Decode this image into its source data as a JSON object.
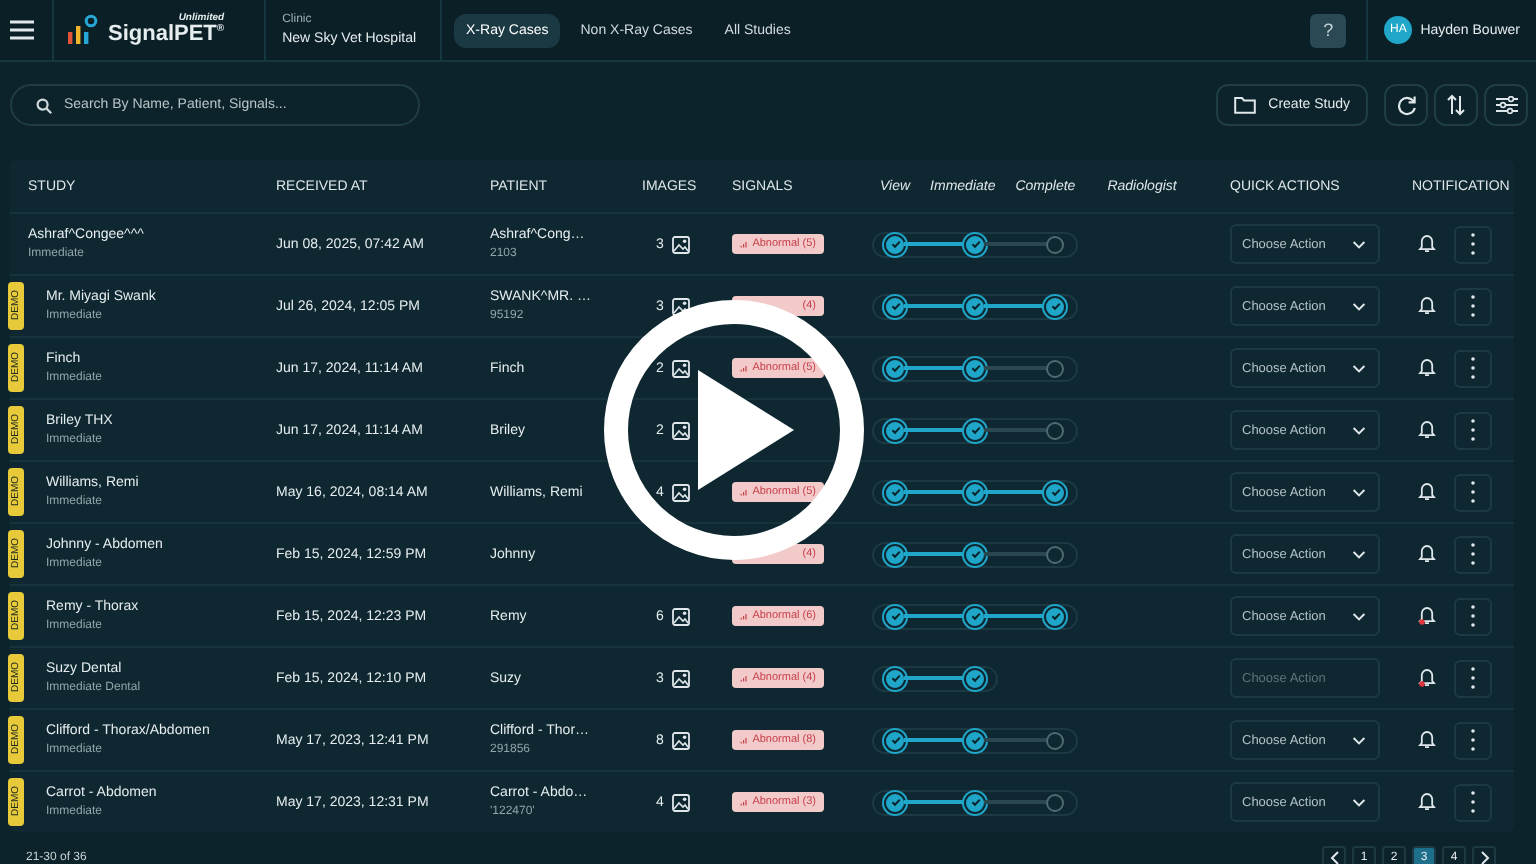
{
  "header": {
    "logo": {
      "tagline": "Unlimited",
      "name": "SignalPET$^{®}$"
    },
    "clinic": {
      "label": "Clinic",
      "name": "New Sky Vet Hospital"
    },
    "tabs": [
      {
        "label": "X-Ray Cases",
        "selected": true
      },
      {
        "label": "Non X-Ray Cases",
        "selected": false
      },
      {
        "label": "All Studies",
        "selected": false
      }
    ],
    "help": "?",
    "user": {
      "initials": "HA",
      "name": "Hayden Bouwer"
    }
  },
  "toolbar": {
    "search": {
      "placeholder": "Search By Name, Patient, Signals..."
    },
    "create_button": "Create Study"
  },
  "table": {
    "columns": [
      {
        "label": "STUDY",
        "kind": "field"
      },
      {
        "label": "RECEIVED AT",
        "kind": "field"
      },
      {
        "label": "PATIENT",
        "kind": "field"
      },
      {
        "label": "IMAGES",
        "kind": "field"
      },
      {
        "label": "SIGNALS",
        "kind": "field"
      },
      {
        "label": "View",
        "kind": "step"
      },
      {
        "label": "Immediate",
        "kind": "step"
      },
      {
        "label": "Complete",
        "kind": "step"
      },
      {
        "label": "Radiologist",
        "kind": "step"
      },
      {
        "label": "QUICK ACTIONS",
        "kind": "field"
      },
      {
        "label": "NOTIFICATION",
        "kind": "field"
      }
    ],
    "rows": [
      {
        "study": "Ashraf^Congee^^^",
        "priority": "Immediate",
        "received": "Jun 08, 2025, 07:42 AM",
        "patient": "Ashraf^Cong…",
        "patient_id": "2103",
        "images": "3",
        "signal": "Abnormal (5)",
        "steps": [
          true,
          true,
          false
        ],
        "action": {
          "text": "Choose Action",
          "disabled": false
        },
        "alert": false
      },
      {
        "tag": "DEMO",
        "study": "Mr. Miyagi Swank",
        "priority": "Immediate",
        "received": "Jul 26, 2024, 12:05 PM",
        "patient": "SWANK^MR. …",
        "patient_id": "95192",
        "images": "3",
        "signal": "(4)",
        "signal_icon": false,
        "steps": [
          true,
          true,
          true
        ],
        "action": {
          "text": "Choose Action",
          "disabled": false
        },
        "alert": false
      },
      {
        "tag": "DEMO",
        "study": "Finch",
        "priority": "Immediate",
        "received": "Jun 17, 2024, 11:14 AM",
        "patient": "Finch",
        "images": "2",
        "signal": "Abnormal (5)",
        "steps": [
          true,
          true,
          false
        ],
        "action": {
          "text": "Choose Action",
          "disabled": false
        },
        "alert": false
      },
      {
        "tag": "DEMO",
        "study": "Briley THX",
        "priority": "Immediate",
        "received": "Jun 17, 2024, 11:14 AM",
        "patient": "Briley",
        "images": "2",
        "steps": [
          true,
          true,
          false
        ],
        "action": {
          "text": "Choose Action",
          "disabled": false
        },
        "alert": false
      },
      {
        "tag": "DEMO",
        "study": "Williams, Remi",
        "priority": "Immediate",
        "received": "May 16, 2024, 08:14 AM",
        "patient": "Williams, Remi",
        "images": "4",
        "signal": "Abnormal (5)",
        "steps": [
          true,
          true,
          true
        ],
        "action": {
          "text": "Choose Action",
          "disabled": false
        },
        "alert": false
      },
      {
        "tag": "DEMO",
        "study": "Johnny - Abdomen",
        "priority": "Immediate",
        "received": "Feb 15, 2024, 12:59 PM",
        "patient": "Johnny",
        "signal": "(4)",
        "signal_icon": false,
        "steps": [
          true,
          true,
          false
        ],
        "action": {
          "text": "Choose Action",
          "disabled": false
        },
        "alert": false
      },
      {
        "tag": "DEMO",
        "study": "Remy - Thorax",
        "priority": "Immediate",
        "received": "Feb 15, 2024, 12:23 PM",
        "patient": "Remy",
        "images": "6",
        "signal": "Abnormal (6)",
        "steps": [
          true,
          true,
          true
        ],
        "action": {
          "text": "Choose Action",
          "disabled": false
        },
        "alert": true
      },
      {
        "tag": "DEMO",
        "study": "Suzy Dental",
        "priority": "Immediate Dental",
        "received": "Feb 15, 2024, 12:10 PM",
        "patient": "Suzy",
        "images": "3",
        "signal": "Abnormal (4)",
        "steps": [
          true,
          true
        ],
        "action": {
          "text": "Choose Action",
          "disabled": true
        },
        "alert": true
      },
      {
        "tag": "DEMO",
        "study": "Clifford - Thorax/Abdomen",
        "priority": "Immediate",
        "received": "May 17, 2023, 12:41 PM",
        "patient": "Clifford - Thor…",
        "patient_id": "291856",
        "images": "8",
        "signal": "Abnormal (8)",
        "steps": [
          true,
          true,
          false
        ],
        "action": {
          "text": "Choose Action",
          "disabled": false
        },
        "alert": false
      },
      {
        "tag": "DEMO",
        "study": "Carrot - Abdomen",
        "priority": "Immediate",
        "received": "May 17, 2023, 12:31 PM",
        "patient": "Carrot - Abdo…",
        "patient_id": "'122470'",
        "images": "4",
        "signal": "Abnormal (3)",
        "steps": [
          true,
          true,
          false
        ],
        "action": {
          "text": "Choose Action",
          "disabled": false
        },
        "alert": false
      }
    ]
  },
  "pagination": {
    "range": "21-30 of 36",
    "pages": [
      {
        "label": "1",
        "selected": false
      },
      {
        "label": "2",
        "selected": false
      },
      {
        "label": "3",
        "selected": true
      },
      {
        "label": "4",
        "selected": false
      }
    ]
  },
  "video": {
    "kind": "play_overlay"
  }
}
